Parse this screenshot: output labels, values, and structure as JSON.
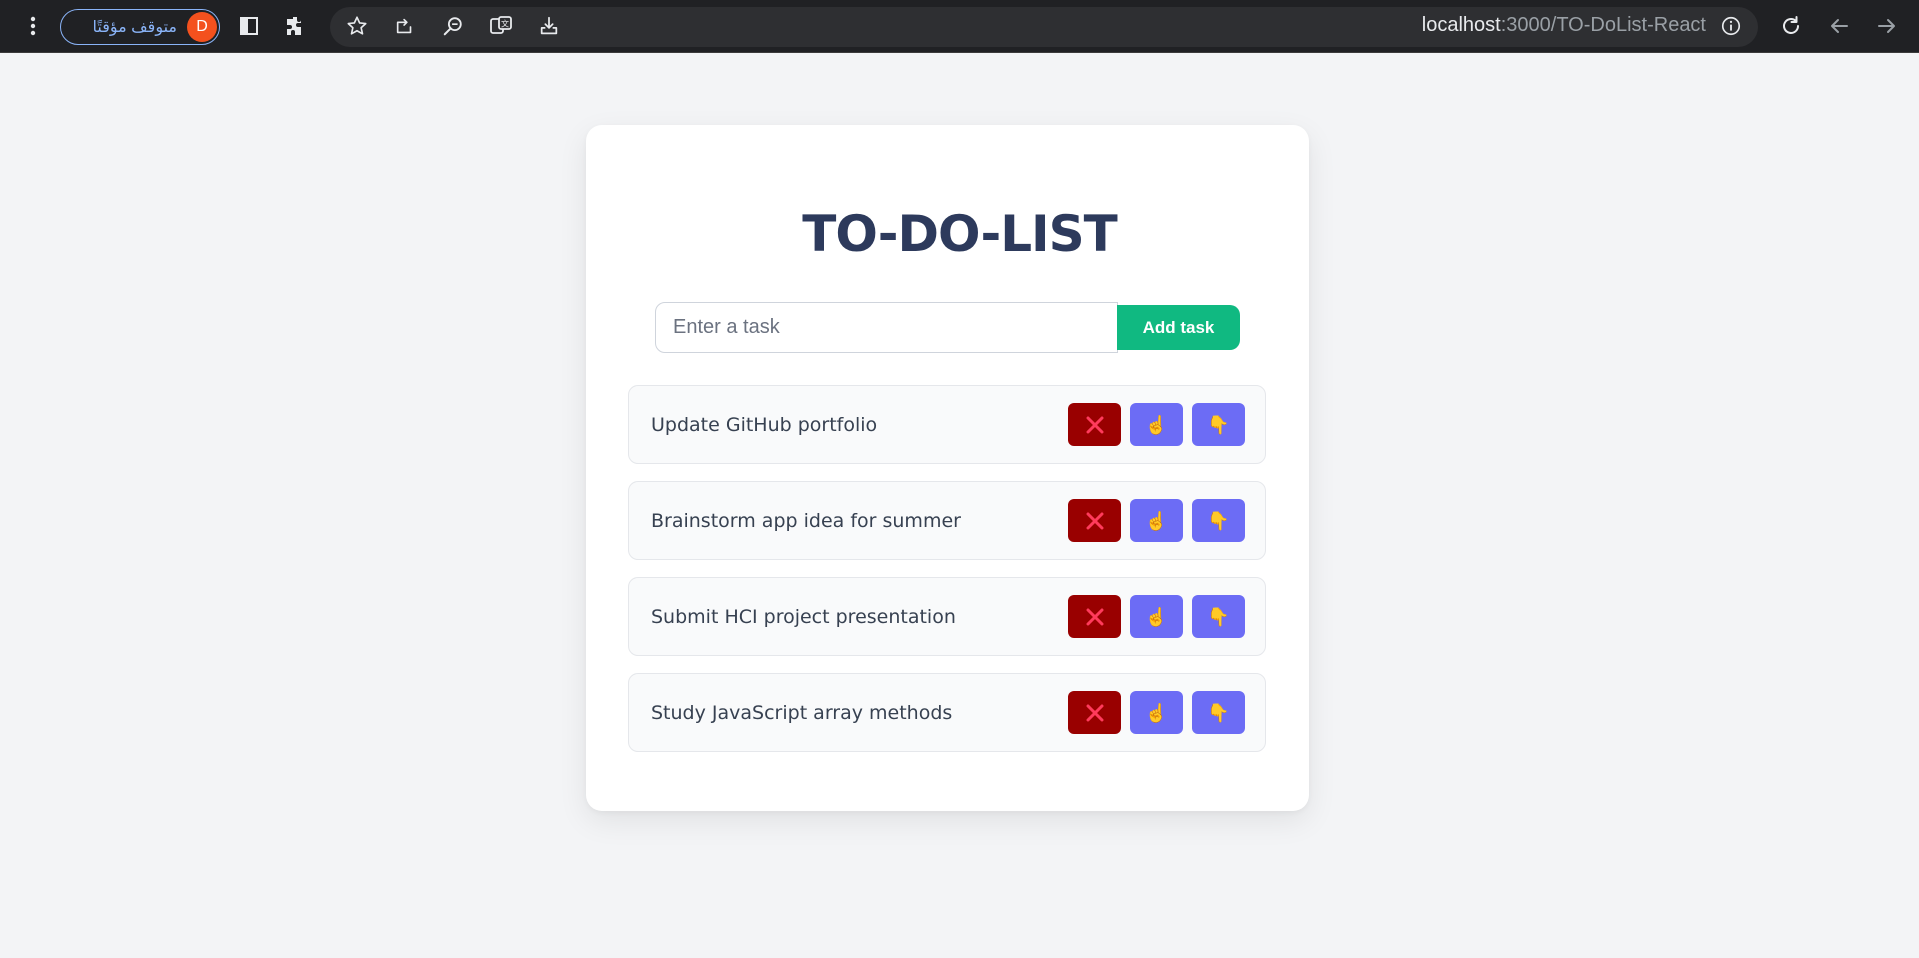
{
  "browser": {
    "profile_label": "متوقف مؤقتًا",
    "profile_initial": "D",
    "url_host": "localhost",
    "url_path": ":3000/TO-DoList-React",
    "icons": [
      "menu-icon",
      "sidebar-icon",
      "extensions-icon",
      "bookmark-star-icon",
      "share-icon",
      "zoom-icon",
      "translate-icon",
      "install-icon",
      "site-info-icon",
      "reload-icon",
      "back-icon",
      "forward-icon"
    ]
  },
  "app": {
    "title": "TO-DO-LIST",
    "input": {
      "placeholder": "Enter a task",
      "value": ""
    },
    "add_button_label": "Add task",
    "tasks": [
      {
        "text": "Update GitHub portfolio"
      },
      {
        "text": "Brainstorm app idea for summer"
      },
      {
        "text": "Submit HCI project presentation"
      },
      {
        "text": "Study JavaScript array methods"
      }
    ],
    "task_buttons": {
      "delete_glyph": "✕",
      "up_glyph": "☝",
      "down_glyph": "👇"
    },
    "colors": {
      "background": "#f3f4f6",
      "title": "#2d3a5c",
      "add_button": "#10b981",
      "delete_button": "#990000",
      "move_button": "#6c6cf5",
      "delete_icon": "#ff3b5c",
      "hand_icon": "#f6b73c"
    }
  }
}
